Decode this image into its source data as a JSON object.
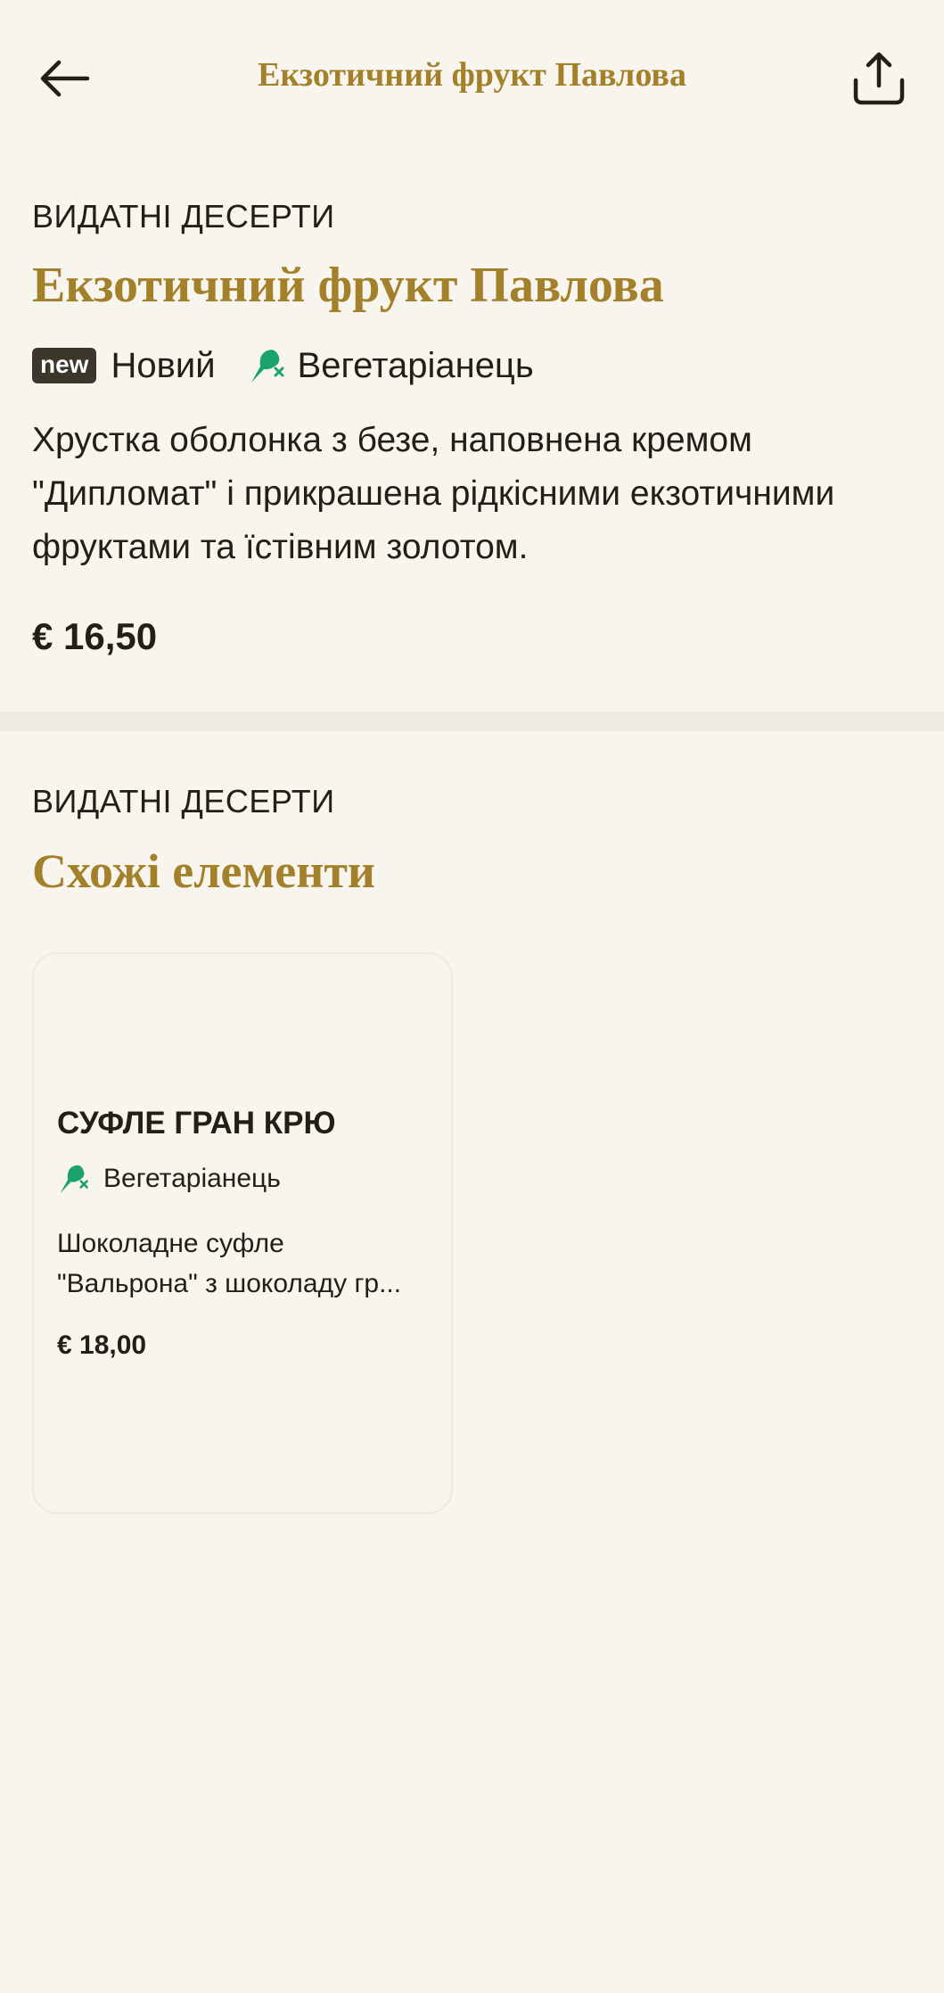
{
  "header": {
    "title": "Екзотичний фрукт Павлова",
    "back_icon": "arrow-left-icon",
    "share_icon": "share-icon"
  },
  "product": {
    "category": "ВИДАТНІ ДЕСЕРТИ",
    "title": "Екзотичний фрукт Павлова",
    "badge": "new",
    "tag_new": "Новий",
    "tag_veg": "Вегетаріанець",
    "description": "Хрустка оболонка з безе, наповнена кремом \"Дипломат\" і прикрашена рідкісними екзотичними фруктами та їстівним золотом.",
    "price": "€ 16,50"
  },
  "related": {
    "category": "ВИДАТНІ ДЕСЕРТИ",
    "title": "Схожі елементи",
    "items": [
      {
        "title": "СУФЛЕ ГРАН КРЮ",
        "tag": "Вегетаріанець",
        "desc_line1": "Шоколадне суфле",
        "desc_line2": "\"Вальрона\" з шоколаду гр...",
        "price": "€ 18,00"
      }
    ]
  },
  "colors": {
    "background": "#f8f5ef",
    "accent_gold": "#a3802a",
    "text": "#231f14",
    "veg_green": "#1aa36b",
    "badge_bg": "#3a372b",
    "divider": "#f0ebe1"
  }
}
